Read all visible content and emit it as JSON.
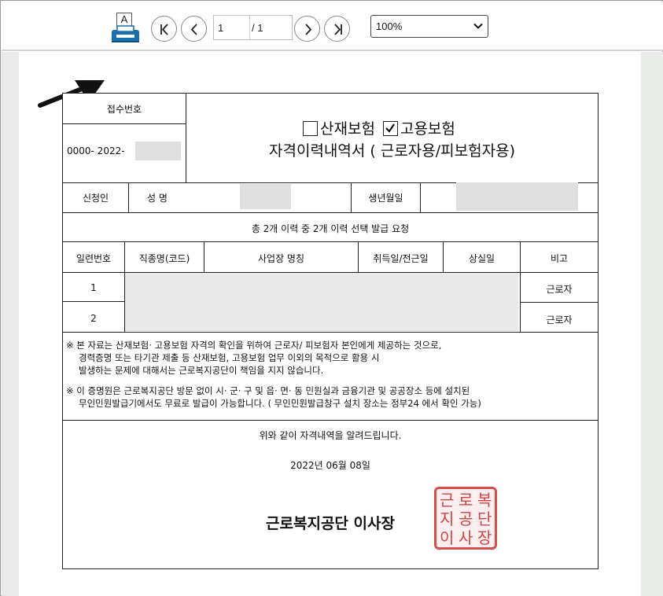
{
  "toolbar": {
    "print_icon_letter": "A",
    "page_current": "1",
    "page_total": "/ 1",
    "zoom": "100%"
  },
  "doc": {
    "receipt_label": "접수번호",
    "receipt_no": "0000- 2022-",
    "insurance_1": "산재보험",
    "insurance_2": "고용보험",
    "title": "자격이력내역서 ( 근로자용/피보험자용)",
    "applicant_label": "신청인",
    "name_label": "성 명",
    "birth_label": "생년월일",
    "summary": "총 2개 이력 중 2개 이력 선택 발급 요청",
    "headers": [
      "일련번호",
      "직종명(코드)",
      "사업장 명칭",
      "취득일/전근일",
      "상실일",
      "비고"
    ],
    "rows": [
      {
        "no": "1",
        "note": "근로자"
      },
      {
        "no": "2",
        "note": "근로자"
      }
    ],
    "notice_1": [
      "※ 본 자료는 산재보험· 고용보험 자격의 확인을 위하여 근로자/ 피보험자 본인에게 제공하는 것으로,",
      "경력증명 또는 타기관 제출 등 산재보험, 고용보험 업무 이외의 목적으로 활용 시",
      "발생하는 문제에 대해서는 근로복지공단이 책임을 지지 않습니다."
    ],
    "notice_2": [
      "※ 이 증명원은 근로복지공단 방문 없이 시· 군· 구 및 읍· 면· 동 민원실과 금융기관 및 공공장소 등에 설치된",
      "무인민원발급기에서도 무료로 발급이 가능합니다. ( 무인민원발급창구 설치 장소는 정부24 에서 확인 가능)"
    ],
    "confirm_text": "위와 같이 자격내역을 알려드립니다.",
    "date": "2022년 06월 08일",
    "issuer": "근로복지공단 이사장",
    "seal_chars": [
      "근",
      "로",
      "복",
      "지",
      "공",
      "단",
      "이",
      "사",
      "장"
    ]
  },
  "colors": {
    "print_icon": "#1a6fb0",
    "seal": "#d23a3a",
    "viewer_bg": "#e9ebe9"
  }
}
